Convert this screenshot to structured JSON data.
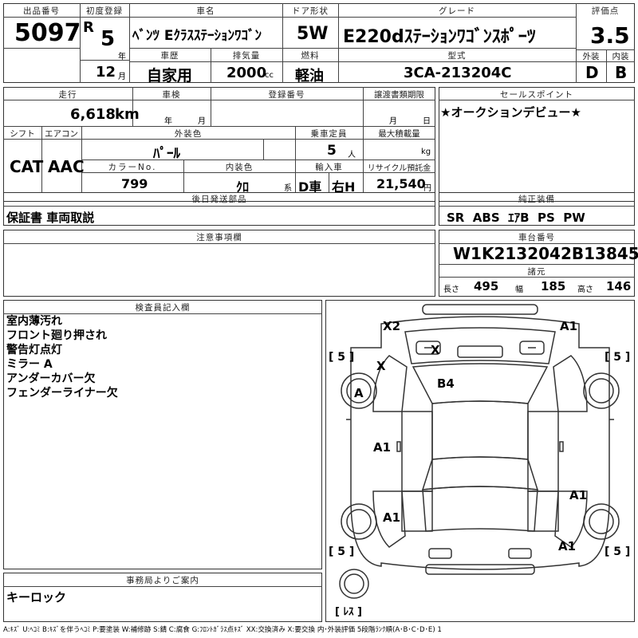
{
  "header": {
    "lot_label": "出品番号",
    "lot_no": "5097",
    "reg_label": "初度登録",
    "era": "R",
    "year": "5",
    "year_unit": "年",
    "month": "12",
    "month_unit": "月",
    "name_label": "車名",
    "car_name": "ﾍﾞﾝﾂ Eｸﾗｽｽﾃｰｼｮﾝﾜｺﾞﾝ",
    "door_label": "ドア形状",
    "door": "5W",
    "grade_label": "グレード",
    "grade": "E220dｽﾃｰｼｮﾝﾜｺﾞﾝｽﾎﾟｰﾂ",
    "score_label": "評価点",
    "score": "3.5",
    "history_label": "車歴",
    "history": "自家用",
    "disp_label": "排気量",
    "disp": "2000",
    "disp_unit": "cc",
    "fuel_label": "燃料",
    "fuel": "軽油",
    "model_label": "型式",
    "model": "3CA-213204C",
    "ext_label": "外装",
    "ext": "D",
    "int_label": "内装",
    "int": "B"
  },
  "row2": {
    "mileage_label": "走行",
    "mileage": "6,618",
    "mileage_unit": "km",
    "inspection_label": "車検",
    "insp_year": "年",
    "insp_month": "月",
    "regno_label": "登録番号",
    "transfer_label": "譲渡書類期限",
    "tr_month": "月",
    "tr_day": "日",
    "sales_label": "セールスポイント",
    "sales": "★オークションデビュー★"
  },
  "row3": {
    "shift_label": "シフト",
    "shift": "CAT",
    "ac_label": "エアコン",
    "ac": "AAC",
    "color_label": "外装色",
    "color": "ﾊﾟｰﾙ",
    "capacity_label": "乗車定員",
    "capacity": "5",
    "capacity_unit": "人",
    "load_label": "最大積載量",
    "load_unit": "kg",
    "colorno_label": "カラーNo.",
    "colorno": "799",
    "interior_label": "内装色",
    "interior": "ｸﾛ",
    "interior_unit": "系",
    "import_label": "輸入車",
    "import1": "D車",
    "import2": "右H",
    "recycle_label": "リサイクル預託金",
    "recycle": "21,540",
    "recycle_unit": "円"
  },
  "row4": {
    "later_label": "後日発送部品",
    "later": "保証書 車両取説",
    "equip_label": "純正装備",
    "equip": "SR  ABS  ｴｱB  PS  PW"
  },
  "row5": {
    "caution_label": "注意事項欄",
    "chassis_label": "車台番号",
    "chassis": "W1K2132042B138452",
    "spec_label": "諸元",
    "len_label": "長さ",
    "len": "495",
    "wid_label": "幅",
    "wid": "185",
    "hgt_label": "高さ",
    "hgt": "146"
  },
  "inspector": {
    "label": "検査員記入欄",
    "lines": [
      "室内薄汚れ",
      "フロント廻り押され",
      "警告灯点灯",
      "ミラー A",
      "アンダーカバー欠",
      "フェンダーライナー欠"
    ]
  },
  "diagram": {
    "marks": [
      "X2",
      "A1",
      "X",
      "X",
      "A",
      "B4",
      "A1",
      "A1",
      "A1",
      "A1"
    ],
    "tires": [
      "[ 5 ]",
      "[ 5 ]",
      "[ 5 ]",
      "[ 5 ]"
    ],
    "spare": "[ ﾚｽ ]"
  },
  "office": {
    "label": "事務局よりご案内",
    "text": "キーロック"
  },
  "legend": "A:ｷｽﾞ U:ﾍｺﾐ B:ｷｽﾞを伴うﾍｺﾐ P:要塗装 W:補修跡 S:錆 C:腐食 G:ﾌﾛﾝﾄｶﾞﾗｽ点ｷｽﾞ XX:交換済み X:要交換  内･外装評価 5段階ﾗﾝｸ順(A･B･C･D･E) 1"
}
